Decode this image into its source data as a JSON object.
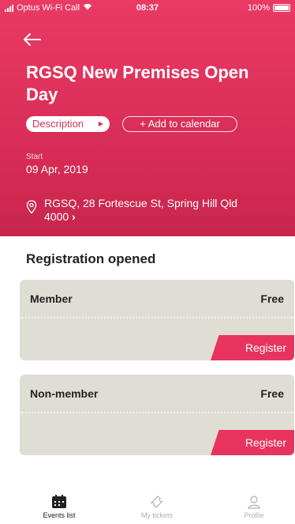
{
  "status_bar": {
    "carrier": "Optus Wi-Fi Call",
    "time": "08:37",
    "battery": "100%"
  },
  "event": {
    "title": "RGSQ New Premises Open Day",
    "description_label": "Description",
    "add_calendar_label": "+ Add to calendar",
    "start_label": "Start",
    "start_date": "09 Apr, 2019",
    "address": "RGSQ, 28 Fortescue St, Spring Hill Qld 4000",
    "address_chevron": "›"
  },
  "registration": {
    "title": "Registration opened",
    "tickets": [
      {
        "name": "Member",
        "price": "Free",
        "button": "Register"
      },
      {
        "name": "Non-member",
        "price": "Free",
        "button": "Register"
      }
    ]
  },
  "tabs": [
    {
      "label": "Events list",
      "icon": "calendar-icon"
    },
    {
      "label": "My tickets",
      "icon": "ticket-icon"
    },
    {
      "label": "Profile",
      "icon": "profile-icon"
    }
  ],
  "colors": {
    "accent": "#e8335f",
    "ticket_bg": "#e0ddd5"
  }
}
